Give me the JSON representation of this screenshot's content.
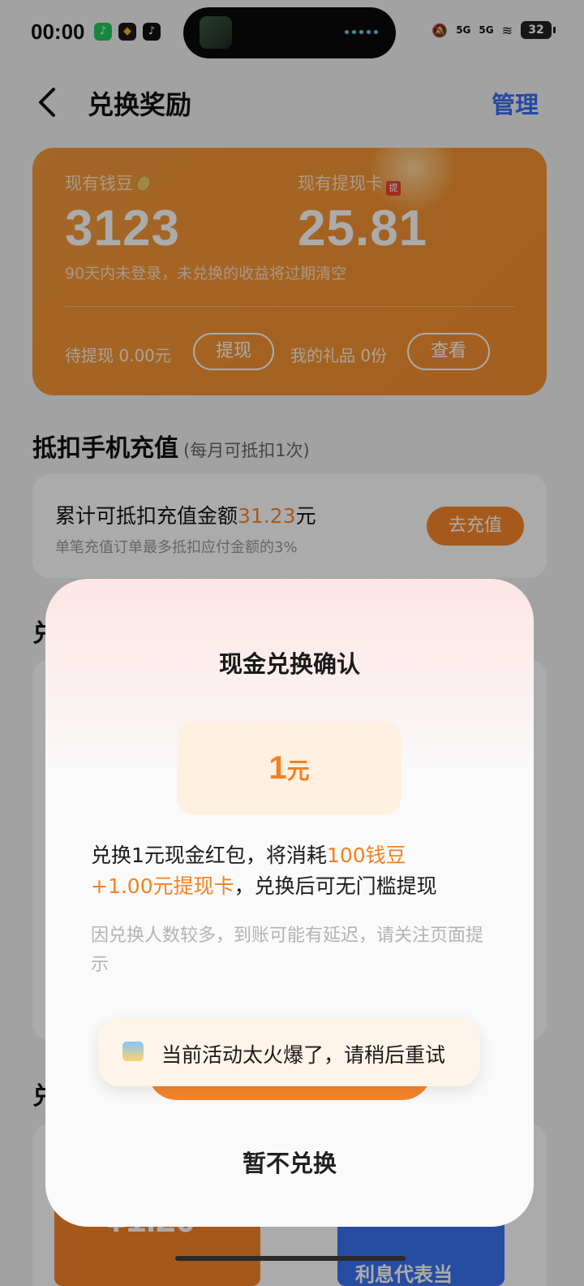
{
  "status_bar": {
    "time": "00:00",
    "apps": [
      "music-app-icon",
      "binance-icon",
      "tiktok-icon"
    ],
    "network_1": "5G",
    "network_2": "5G",
    "battery": "32"
  },
  "header": {
    "title": "兑换奖励",
    "manage_label": "管理"
  },
  "balance_card": {
    "beans_label": "现有钱豆",
    "beans_value": "3123",
    "card_label": "现有提现卡",
    "card_icon_text": "提",
    "card_value": "25.81",
    "expire_note": "90天内未登录，未兑换的收益将过期清空",
    "pending_label": "待提现 0.00元",
    "withdraw_btn": "提现",
    "gifts_label": "我的礼品 0份",
    "view_btn": "查看"
  },
  "section": {
    "title": "抵扣手机充值",
    "subtitle": "(每月可抵扣1次)",
    "recharge_prefix": "累计可抵扣充值金额",
    "recharge_amount": "31.23",
    "recharge_suffix": "元",
    "recharge_sub": "单笔充值订单最多抵扣应付金额的3%",
    "recharge_btn": "去充值"
  },
  "background": {
    "head_1": "兑",
    "head_2": "兑",
    "ticket_value": "¥1.20",
    "ticket_blue_text": "利息代表当"
  },
  "modal": {
    "title": "现金兑换确认",
    "amount_num": "1",
    "amount_unit": "元",
    "desc_1": "兑换1元现金红包，将消耗",
    "desc_hl_1": "100钱豆",
    "desc_hl_2": "+1.00元提现卡",
    "desc_2": "，兑换后可无门槛提现",
    "note": "因兑换人数较多，到账可能有延迟，请关注页面提示",
    "cancel_label": "暂不兑换"
  },
  "toast": {
    "text": "当前活动太火爆了，请稍后重试"
  },
  "colors": {
    "accent_orange": "#f7862b",
    "link_blue": "#3a6cf4"
  }
}
